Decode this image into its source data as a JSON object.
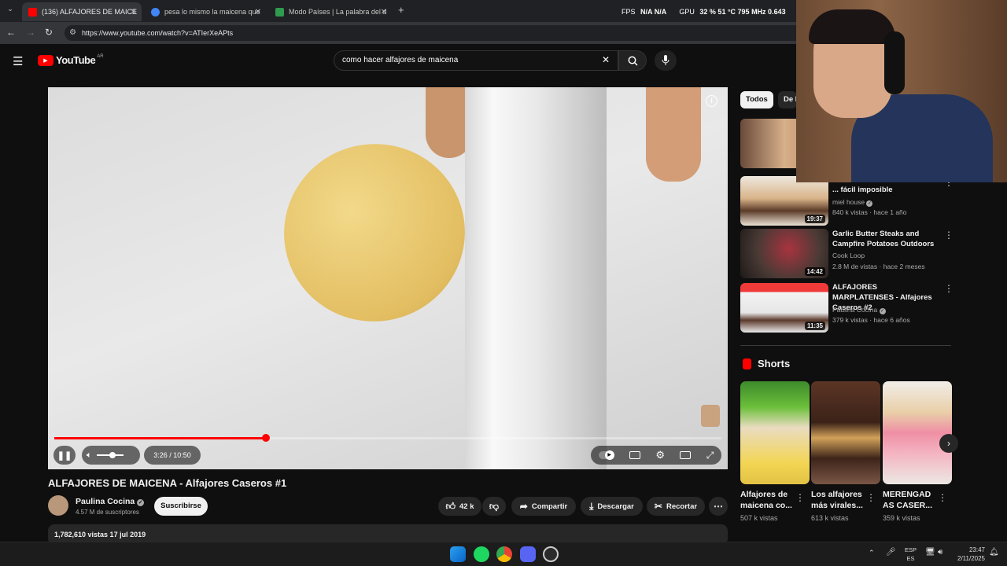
{
  "browser": {
    "tabs": [
      {
        "label": "(136) ALFAJORES DE MAICE",
        "color": "#ff0000"
      },
      {
        "label": "pesa lo mismo la maicena que",
        "color": "#4285f4"
      },
      {
        "label": "Modo Países | La palabra del d",
        "color": "#2e9b4f"
      }
    ],
    "url": "https://www.youtube.com/watch?v=ATIerXeAPts"
  },
  "overlay": {
    "fps_label": "FPS",
    "fps_value": "N/A  N/A",
    "gpu_label": "GPU",
    "gpu_value": "32 %  51 °C  795 MHz  0.643"
  },
  "youtube": {
    "logo_text": "YouTube",
    "region": "AR",
    "search_value": "como hacer alfajores de maicena"
  },
  "player": {
    "time": "3:26 / 10:50",
    "progress": 0.317
  },
  "video": {
    "title": "ALFAJORES DE MAICENA - Alfajores Caseros #1",
    "channel": "Paulina Cocina",
    "subscribers": "4.57 M de suscriptores",
    "subscribe_label": "Suscribirse",
    "likes": "42 k",
    "share_label": "Compartir",
    "download_label": "Descargar",
    "clip_label": "Recortar",
    "views_date": "1,782,610 vistas  17 jul 2019"
  },
  "sidebar": {
    "chips": [
      "Todos",
      "De P"
    ],
    "related": [
      {
        "title": "... fácil imposible",
        "channel": "miel house",
        "meta": "840 k vistas · hace 1 año",
        "duration": "19:37"
      },
      {
        "title": "Garlic Butter Steaks and Campfire Potatoes Outdoors",
        "channel": "Cook Loop",
        "meta": "2.8 M de vistas · hace 2 meses",
        "duration": "14:42"
      },
      {
        "title": "ALFAJORES MARPLATENSES - Alfajores Caseros #2",
        "channel": "Paulina Cocina",
        "meta": "379 k vistas · hace 6 años",
        "duration": "11:35"
      }
    ],
    "shorts_heading": "Shorts",
    "shorts": [
      {
        "title": "Alfajores de maicena co...",
        "views": "507 k vistas"
      },
      {
        "title": "Los alfajores más virales...",
        "views": "613 k vistas"
      },
      {
        "title": "MERENGAD AS CASER...",
        "views": "359 k vistas"
      }
    ]
  },
  "taskbar": {
    "lang1": "ESP",
    "lang2": "ES",
    "time": "23:47",
    "date": "2/11/2025"
  }
}
